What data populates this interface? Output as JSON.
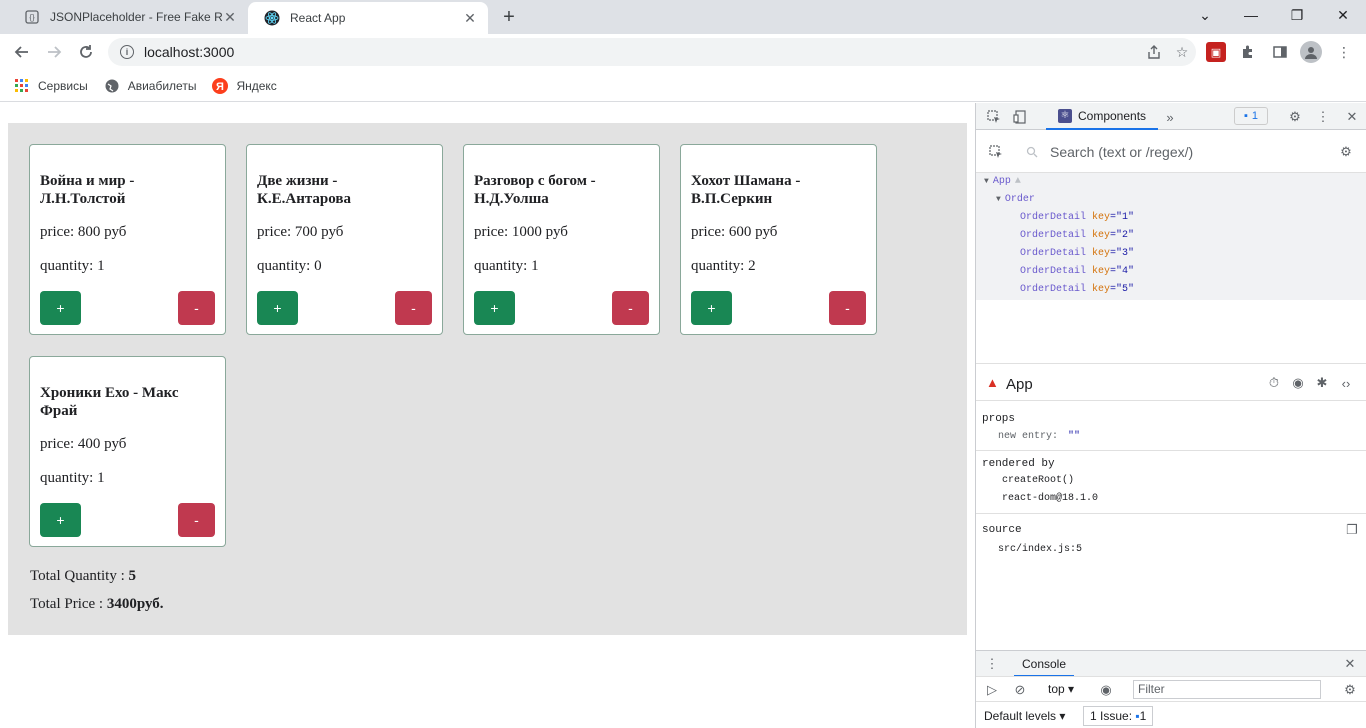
{
  "browser": {
    "tabs": [
      {
        "title": "JSONPlaceholder - Free Fake RES"
      },
      {
        "title": "React App"
      }
    ],
    "address": "localhost:3000",
    "bookmarks": [
      "Сервисы",
      "Авиабилеты",
      "Яндекс"
    ]
  },
  "orders": [
    {
      "title": "Война и мир - Л.Н.Толстой",
      "price": "price: 800 руб",
      "quantity": "quantity: 1"
    },
    {
      "title": "Две жизни - К.Е.Антарова",
      "price": "price: 700 руб",
      "quantity": "quantity: 0"
    },
    {
      "title": "Разговор с богом - Н.Д.Уолша",
      "price": "price: 1000 руб",
      "quantity": "quantity: 1"
    },
    {
      "title": "Хохот Шамана - В.П.Серкин",
      "price": "price: 600 руб",
      "quantity": "quantity: 2"
    },
    {
      "title": "Хроники Ехо - Макс Фрай",
      "price": "price: 400 руб",
      "quantity": "quantity: 1"
    }
  ],
  "buttons": {
    "plus": "+",
    "minus": "-"
  },
  "totals": {
    "quantity_label": "Total Quantity : ",
    "quantity_value": "5",
    "price_label": "Total Price : ",
    "price_value": "3400руб."
  },
  "devtools": {
    "tab": "Components",
    "more": "»",
    "issues_count": "1",
    "search_placeholder": "Search (text or /regex/)",
    "tree": {
      "app": "App",
      "order": "Order",
      "detail_name": "OrderDetail",
      "key_attr": "key",
      "keys": [
        "=\"1\"",
        "=\"2\"",
        "=\"3\"",
        "=\"4\"",
        "=\"5\""
      ]
    },
    "selected": "App",
    "props_label": "props",
    "prop_name": "new entry:",
    "prop_value": "\"\"",
    "rendered_by_label": "rendered by",
    "rendered_by": [
      "createRoot()",
      "react-dom@18.1.0"
    ],
    "source_label": "source",
    "source_value": "src/index.js:5",
    "console_tab": "Console",
    "context": "top",
    "filter_placeholder": "Filter",
    "default_levels": "Default levels",
    "issue_label": "1 Issue:",
    "issue_count": "1"
  }
}
